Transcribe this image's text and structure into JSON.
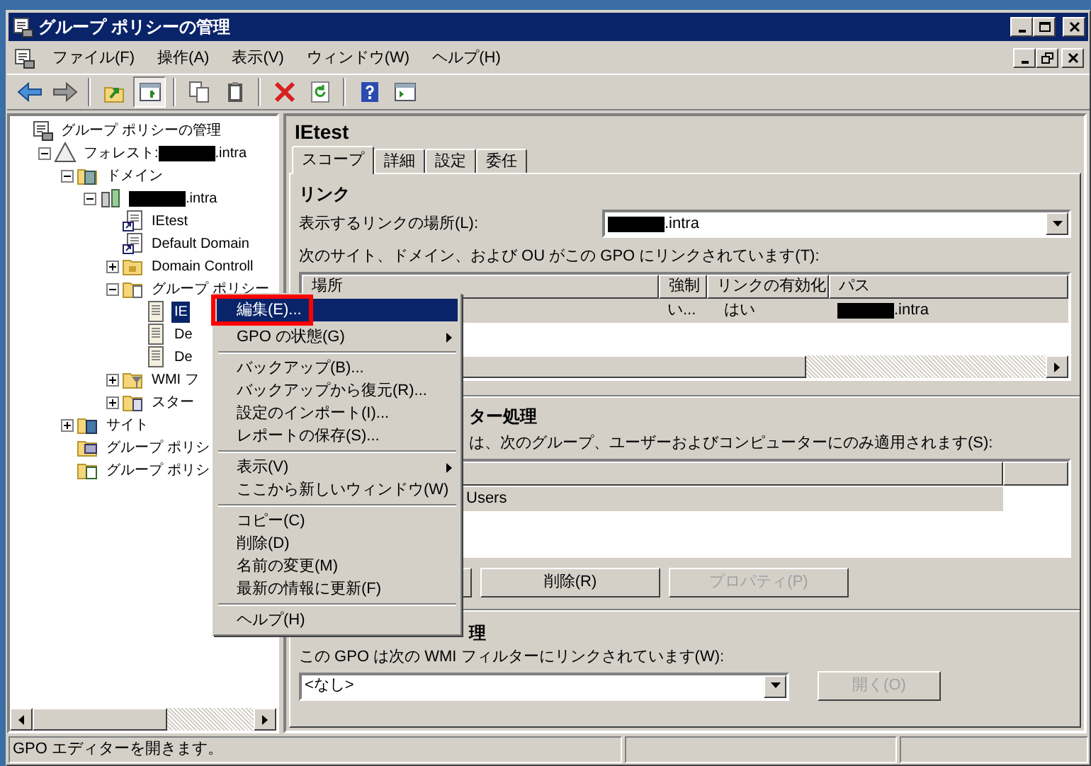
{
  "window": {
    "title": "グループ ポリシーの管理"
  },
  "menu_bar": [
    "ファイル(F)",
    "操作(A)",
    "表示(V)",
    "ウィンドウ(W)",
    "ヘルプ(H)"
  ],
  "toolbar": [
    {
      "kind": "back",
      "pressed": false
    },
    {
      "kind": "forward",
      "pressed": false
    },
    {
      "kind": "separator"
    },
    {
      "kind": "up",
      "pressed": false
    },
    {
      "kind": "tree-toggle",
      "pressed": true
    },
    {
      "kind": "separator"
    },
    {
      "kind": "copy",
      "pressed": false
    },
    {
      "kind": "paste",
      "pressed": false
    },
    {
      "kind": "separator"
    },
    {
      "kind": "delete",
      "pressed": false
    },
    {
      "kind": "refresh",
      "pressed": false
    },
    {
      "kind": "separator"
    },
    {
      "kind": "help",
      "pressed": false
    },
    {
      "kind": "action-pane",
      "pressed": false
    }
  ],
  "tree": [
    {
      "kind": "console",
      "selected": false,
      "segments": [
        {
          "kind": "text",
          "text": "グループ ポリシーの管理"
        }
      ],
      "children": [
        {
          "kind": "forest",
          "expanded": true,
          "selected": false,
          "segments": [
            {
              "kind": "text",
              "text": "フォレスト:"
            },
            {
              "kind": "redaction"
            },
            {
              "kind": "text",
              "text": ".intra"
            }
          ],
          "children": [
            {
              "kind": "domains",
              "expanded": true,
              "selected": false,
              "segments": [
                {
                  "kind": "text",
                  "text": "ドメイン"
                }
              ],
              "children": [
                {
                  "kind": "domain",
                  "expanded": true,
                  "selected": false,
                  "segments": [
                    {
                      "kind": "redaction"
                    },
                    {
                      "kind": "text",
                      "text": ".intra"
                    }
                  ],
                  "children": [
                    {
                      "kind": "gpo-link",
                      "selected": false,
                      "segments": [
                        {
                          "kind": "text",
                          "text": "IEtest"
                        }
                      ]
                    },
                    {
                      "kind": "gpo-link",
                      "selected": false,
                      "segments": [
                        {
                          "kind": "text",
                          "text": "Default Domain"
                        }
                      ]
                    },
                    {
                      "kind": "ou",
                      "expanded": false,
                      "selected": false,
                      "segments": [
                        {
                          "kind": "text",
                          "text": "Domain Controll"
                        }
                      ]
                    },
                    {
                      "kind": "gpo-folder",
                      "expanded": true,
                      "selected": false,
                      "segments": [
                        {
                          "kind": "text",
                          "text": "グループ ポリシー"
                        }
                      ],
                      "children": [
                        {
                          "kind": "gpo",
                          "selected": true,
                          "segments": [
                            {
                              "kind": "text",
                              "text": "IE"
                            }
                          ]
                        },
                        {
                          "kind": "gpo",
                          "selected": false,
                          "segments": [
                            {
                              "kind": "text",
                              "text": "De"
                            }
                          ]
                        },
                        {
                          "kind": "gpo",
                          "selected": false,
                          "segments": [
                            {
                              "kind": "text",
                              "text": "De"
                            }
                          ]
                        }
                      ]
                    },
                    {
                      "kind": "wmi",
                      "expanded": false,
                      "selected": false,
                      "segments": [
                        {
                          "kind": "text",
                          "text": "WMI フ"
                        }
                      ]
                    },
                    {
                      "kind": "starter",
                      "expanded": false,
                      "selected": false,
                      "segments": [
                        {
                          "kind": "text",
                          "text": "スター"
                        }
                      ]
                    }
                  ]
                }
              ]
            },
            {
              "kind": "sites",
              "expanded": false,
              "selected": false,
              "segments": [
                {
                  "kind": "text",
                  "text": "サイト"
                }
              ]
            },
            {
              "kind": "modeling",
              "selected": false,
              "segments": [
                {
                  "kind": "text",
                  "text": "グループ ポリシ"
                }
              ]
            },
            {
              "kind": "results",
              "selected": false,
              "segments": [
                {
                  "kind": "text",
                  "text": "グループ ポリシ"
                }
              ]
            }
          ]
        }
      ]
    }
  ],
  "details": {
    "title": "IEtest",
    "tabs": [
      {
        "label": "スコープ",
        "selected": true
      },
      {
        "label": "詳細",
        "selected": false
      },
      {
        "label": "設定",
        "selected": false
      },
      {
        "label": "委任",
        "selected": false
      }
    ],
    "links": {
      "heading": "リンク",
      "location_label": "表示するリンクの場所(L):",
      "location_value": [
        {
          "kind": "redaction"
        },
        {
          "kind": "text",
          "text": ".intra"
        }
      ],
      "list_label": "次のサイト、ドメイン、および OU がこの GPO にリンクされています(T):",
      "columns": [
        "場所",
        "強制",
        "リンクの有効化",
        "パス"
      ],
      "rows": [
        {
          "selected": true,
          "enforced": "い...",
          "enabled": "はい",
          "path": [
            {
              "kind": "redaction"
            },
            {
              "kind": "text",
              "text": ".intra"
            }
          ]
        }
      ]
    },
    "security": {
      "heading": "ター処理",
      "label": "は、次のグループ、ユーザーおよびコンピューターにのみ適用されます(S):",
      "rows": [
        {
          "name": "Users",
          "selected": true
        }
      ],
      "buttons": [
        {
          "kind": "covered"
        },
        {
          "kind": "labeled",
          "label": "削除(R)",
          "disabled": false
        },
        {
          "kind": "labeled",
          "label": "プロパティ(P)",
          "disabled": true
        }
      ]
    },
    "wmi": {
      "heading": "理",
      "label": "この GPO は次の WMI フィルターにリンクされています(W):",
      "value": "<なし>",
      "open_button": {
        "label": "開く(O)",
        "disabled": true
      }
    }
  },
  "context_menu": [
    {
      "kind": "item",
      "label": "編集(E)...",
      "selected": true,
      "submenu": false
    },
    {
      "kind": "item",
      "label": "GPO の状態(G)",
      "selected": false,
      "submenu": true
    },
    {
      "kind": "separator"
    },
    {
      "kind": "item",
      "label": "バックアップ(B)...",
      "selected": false,
      "submenu": false
    },
    {
      "kind": "item",
      "label": "バックアップから復元(R)...",
      "selected": false,
      "submenu": false
    },
    {
      "kind": "item",
      "label": "設定のインポート(I)...",
      "selected": false,
      "submenu": false
    },
    {
      "kind": "item",
      "label": "レポートの保存(S)...",
      "selected": false,
      "submenu": false
    },
    {
      "kind": "separator"
    },
    {
      "kind": "item",
      "label": "表示(V)",
      "selected": false,
      "submenu": true
    },
    {
      "kind": "item",
      "label": "ここから新しいウィンドウ(W)",
      "selected": false,
      "submenu": false
    },
    {
      "kind": "separator"
    },
    {
      "kind": "item",
      "label": "コピー(C)",
      "selected": false,
      "submenu": false
    },
    {
      "kind": "item",
      "label": "削除(D)",
      "selected": false,
      "submenu": false
    },
    {
      "kind": "item",
      "label": "名前の変更(M)",
      "selected": false,
      "submenu": false
    },
    {
      "kind": "item",
      "label": "最新の情報に更新(F)",
      "selected": false,
      "submenu": false
    },
    {
      "kind": "separator"
    },
    {
      "kind": "item",
      "label": "ヘルプ(H)",
      "selected": false,
      "submenu": false
    }
  ],
  "status_bar": {
    "text": "GPO エディターを開きます。"
  }
}
